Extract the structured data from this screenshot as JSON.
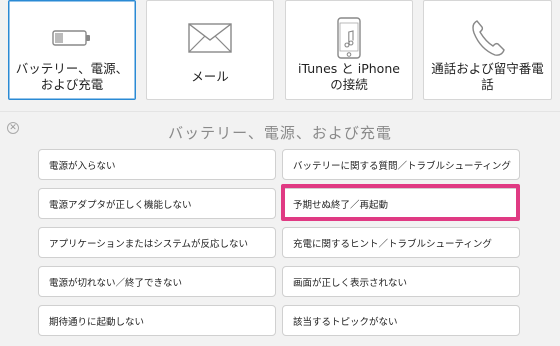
{
  "topics": [
    {
      "label": "バッテリー、電源、および充電",
      "icon": "battery-icon"
    },
    {
      "label": "メール",
      "icon": "envelope-icon"
    },
    {
      "label": "iTunes と iPhone の接続",
      "icon": "itunes-phone-icon"
    },
    {
      "label": "通話および留守番電話",
      "icon": "phone-handset-icon"
    }
  ],
  "panel": {
    "title": "バッテリー、電源、および充電",
    "close_icon": "close-icon",
    "options_left": [
      "電源が入らない",
      "電源アダプタが正しく機能しない",
      "アプリケーションまたはシステムが反応しない",
      "電源が切れない／終了できない",
      "期待通りに起動しない"
    ],
    "options_right": [
      "バッテリーに関する質問／トラブルシューティング",
      "予期せぬ終了／再起動",
      "充電に関するヒント／トラブルシューティング",
      "画面が正しく表示されない",
      "該当するトピックがない"
    ]
  },
  "colors": {
    "active_border": "#2a8ad4",
    "highlight": "#e03a83"
  }
}
